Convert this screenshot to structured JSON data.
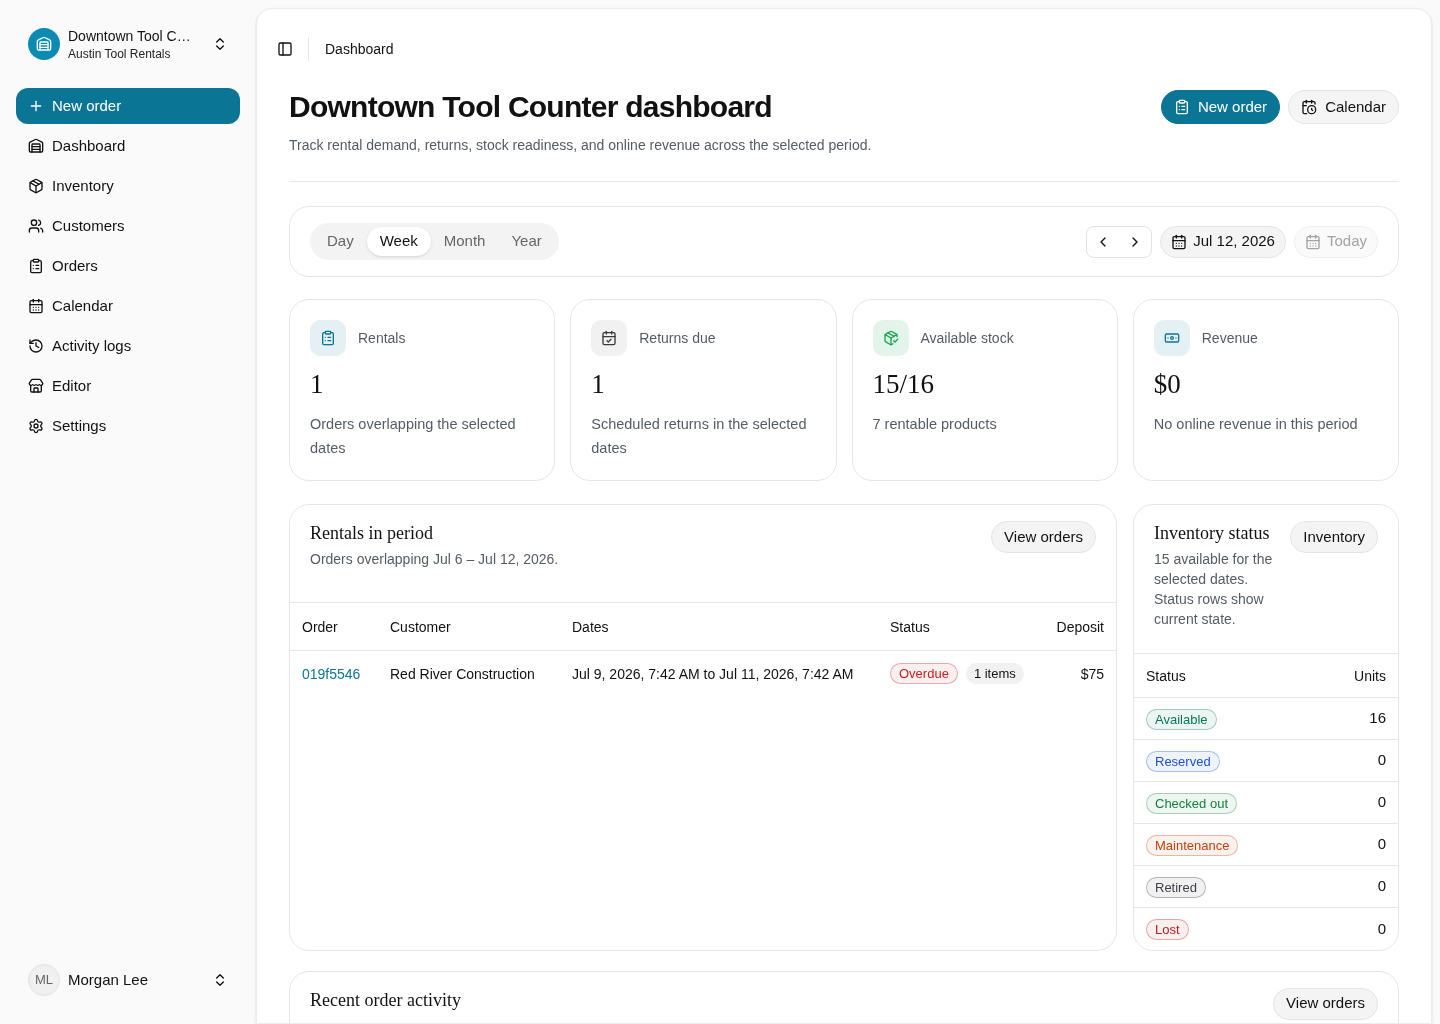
{
  "sidebar": {
    "workspace": {
      "name": "Downtown Tool C…",
      "subtitle": "Austin Tool Rentals"
    },
    "new_order_button": "New order",
    "nav_items": [
      {
        "label": "Dashboard",
        "selected": false
      },
      {
        "label": "Inventory",
        "selected": false
      },
      {
        "label": "Customers",
        "selected": false
      },
      {
        "label": "Orders",
        "selected": false
      },
      {
        "label": "Calendar",
        "selected": false
      },
      {
        "label": "Activity logs",
        "selected": false
      },
      {
        "label": "Editor",
        "selected": false
      },
      {
        "label": "Settings",
        "selected": false
      }
    ],
    "user": {
      "initials": "ML",
      "name": "Morgan Lee"
    }
  },
  "header": {
    "breadcrumb": "Dashboard"
  },
  "page": {
    "title": "Downtown Tool Counter dashboard",
    "subtitle": "Track rental demand, returns, stock readiness, and online revenue across the selected period.",
    "actions": [
      {
        "label": "New order",
        "kind": "primary"
      },
      {
        "label": "Calendar",
        "kind": "secondary"
      }
    ]
  },
  "filters": {
    "periods": [
      {
        "label": "Day",
        "selected": false
      },
      {
        "label": "Week",
        "selected": true
      },
      {
        "label": "Month",
        "selected": false
      },
      {
        "label": "Year",
        "selected": false
      }
    ],
    "date": "Jul 12, 2026",
    "today": {
      "label": "Today",
      "disabled": true
    }
  },
  "stats": [
    {
      "label": "Rentals",
      "value": "1",
      "description": "Orders overlapping the selected dates"
    },
    {
      "label": "Returns due",
      "value": "1",
      "description": "Scheduled returns in the selected dates"
    },
    {
      "label": "Available stock",
      "value": "15/16",
      "description": "7 rentable products"
    },
    {
      "label": "Revenue",
      "value": "$0",
      "description": "No online revenue in this period"
    }
  ],
  "rentals": {
    "title": "Rentals in period",
    "subtitle": "Orders overlapping Jul 6 – Jul 12, 2026.",
    "button": "View orders",
    "columns": [
      "Order",
      "Customer",
      "Dates",
      "Status",
      "Deposit"
    ],
    "rows": [
      {
        "order": "019f5546",
        "customer": "Red River Construction",
        "dates": "Jul 9, 2026, 7:42 AM to Jul 11, 2026, 7:42 AM",
        "status": {
          "label": "Overdue",
          "color": "#c81e1e"
        },
        "items": "1 items",
        "deposit": "$75"
      }
    ]
  },
  "inventory_status": {
    "title": "Inventory status",
    "subtitle": "15 available for the selected dates. Status rows show current state.",
    "button": "Inventory",
    "columns": [
      "Status",
      "Units"
    ],
    "rows": [
      {
        "label": "Available",
        "units": "16",
        "color": "#047857"
      },
      {
        "label": "Reserved",
        "units": "0",
        "color": "#1d4ed8"
      },
      {
        "label": "Checked out",
        "units": "0",
        "color": "#15803d"
      },
      {
        "label": "Maintenance",
        "units": "0",
        "color": "#c2410c"
      },
      {
        "label": "Retired",
        "units": "0",
        "color": "#3f3f46"
      },
      {
        "label": "Lost",
        "units": "0",
        "color": "#b91c1c"
      }
    ]
  },
  "recent_activity": {
    "title": "Recent order activity",
    "button": "View orders"
  }
}
